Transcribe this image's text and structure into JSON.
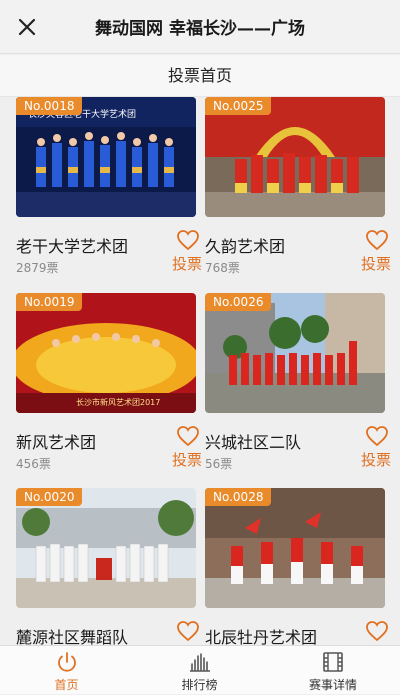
{
  "header": {
    "title": "舞动国网 幸福长沙——广场",
    "close_icon": "close-icon"
  },
  "subheader": {
    "title": "投票首页"
  },
  "colors": {
    "accent": "#e98a2b",
    "vote_text": "#e07020",
    "active_tab": "#e07020"
  },
  "cards": [
    {
      "number": "No.0018",
      "name": "老干大学艺术团",
      "votes": "2879票",
      "vote_label": "投票",
      "image": "stage-performance-blue",
      "image_text": "长沙芙蓉区老干大学艺术团"
    },
    {
      "number": "No.0025",
      "name": "久韵艺术团",
      "votes": "768票",
      "vote_label": "投票",
      "image": "red-costume-group-arch"
    },
    {
      "number": "No.0019",
      "name": "新风艺术团",
      "votes": "456票",
      "vote_label": "投票",
      "image": "yellow-dress-stage",
      "image_text": "长沙市新风艺术团2017"
    },
    {
      "number": "No.0026",
      "name": "兴城社区二队",
      "votes": "56票",
      "vote_label": "投票",
      "image": "red-dress-outdoor-building"
    },
    {
      "number": "No.0020",
      "name": "麓源社区舞蹈队",
      "votes": "",
      "vote_label": "",
      "image": "white-costume-outdoor"
    },
    {
      "number": "No.0028",
      "name": "北辰牡丹艺术团",
      "votes": "",
      "vote_label": "",
      "image": "red-white-fan-dance"
    }
  ],
  "tabs": [
    {
      "label": "首页",
      "icon": "power-icon",
      "active": true
    },
    {
      "label": "排行榜",
      "icon": "bar-chart-icon",
      "active": false
    },
    {
      "label": "赛事详情",
      "icon": "film-icon",
      "active": false
    }
  ]
}
